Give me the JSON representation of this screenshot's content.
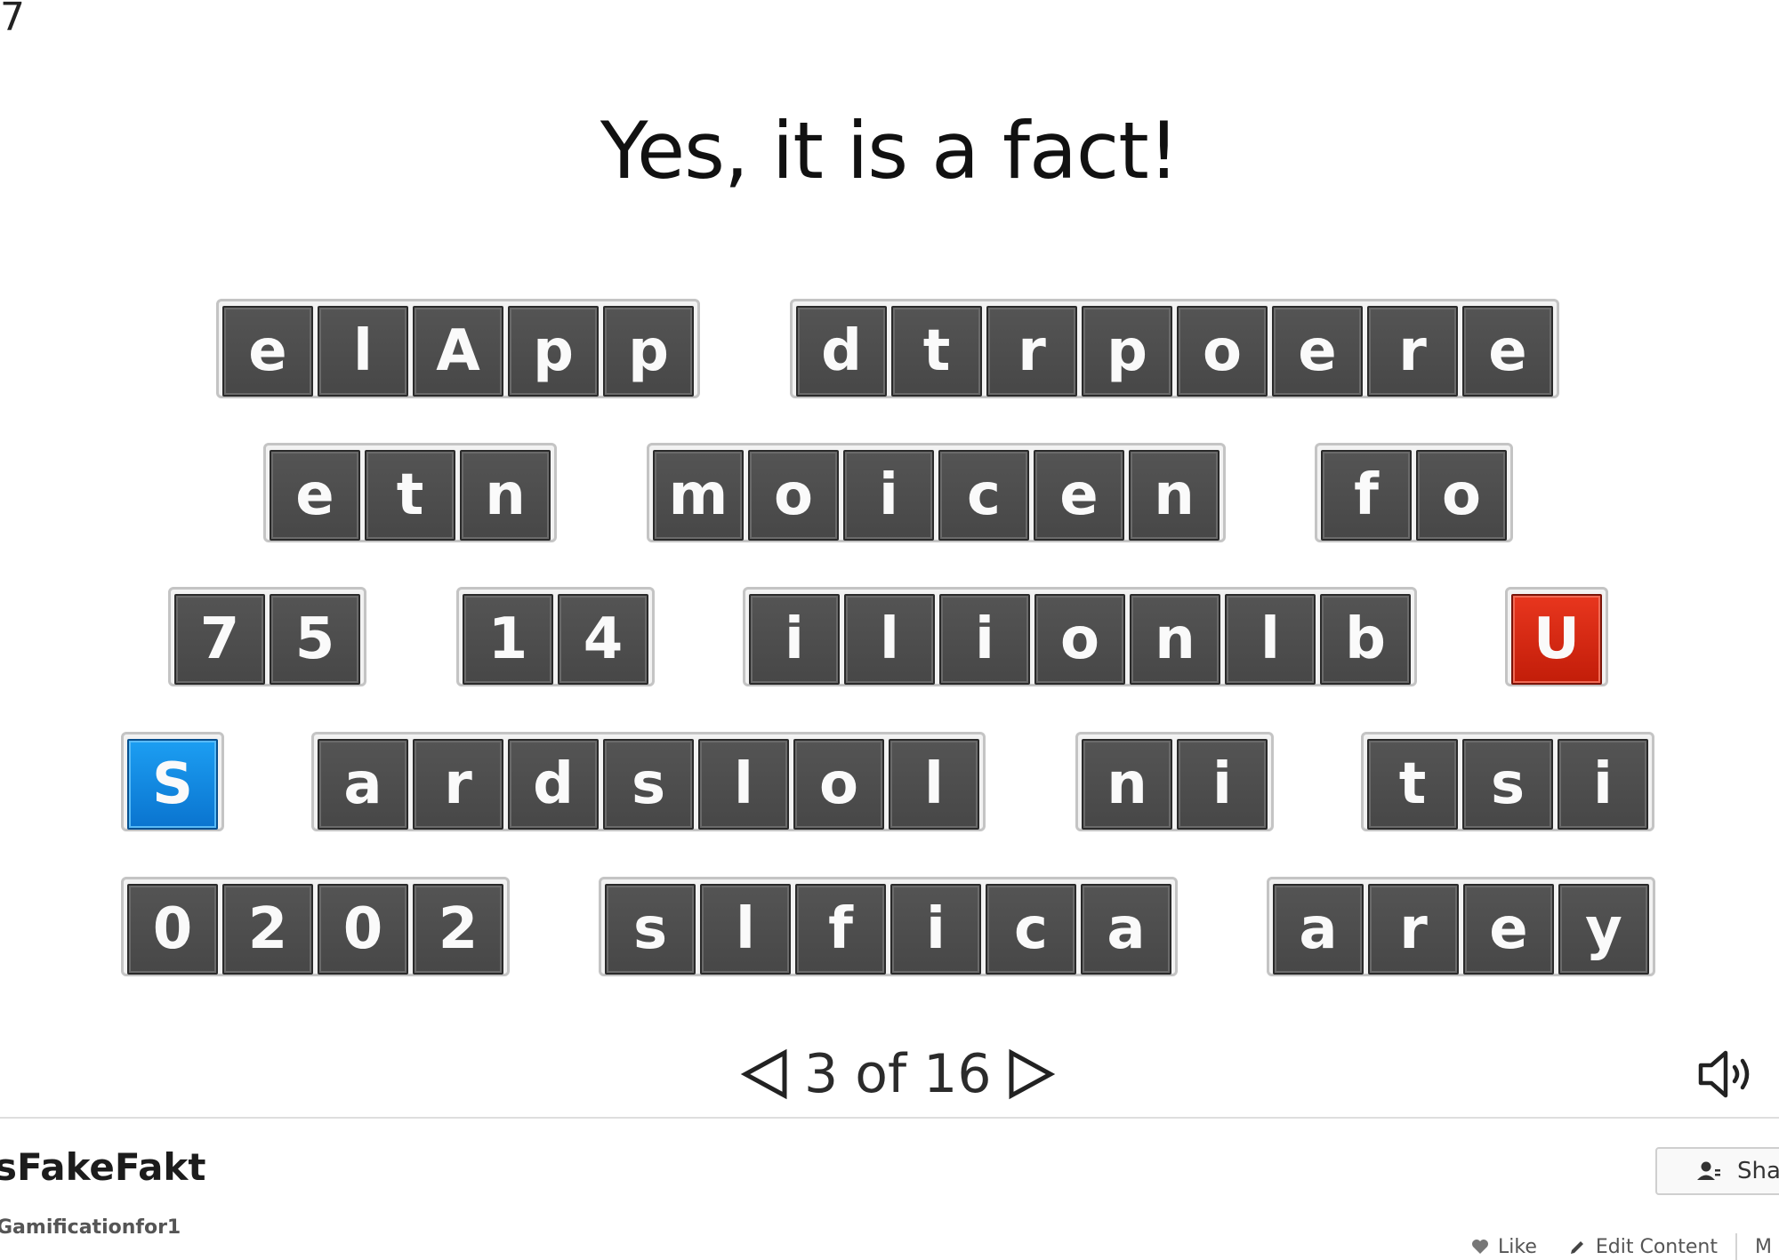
{
  "corner_number": "7",
  "game": {
    "title": "Yes, it is a fact!",
    "rows": [
      [
        {
          "letters": [
            "e",
            "l",
            "A",
            "p",
            "p"
          ]
        },
        {
          "letters": [
            "d",
            "t",
            "r",
            "p",
            "o",
            "e",
            "r",
            "e"
          ]
        }
      ],
      [
        {
          "letters": [
            "e",
            "t",
            "n"
          ]
        },
        {
          "letters": [
            "m",
            "o",
            "i",
            "c",
            "e",
            "n"
          ]
        },
        {
          "letters": [
            "f",
            "o"
          ]
        }
      ],
      [
        {
          "letters": [
            "7",
            "5"
          ]
        },
        {
          "letters": [
            "1",
            "4"
          ]
        },
        {
          "letters": [
            "i",
            "l",
            "i",
            "o",
            "n",
            "l",
            "b"
          ]
        },
        {
          "letters": [
            "U"
          ],
          "color": "red"
        }
      ],
      [
        {
          "letters": [
            "S"
          ],
          "color": "blue"
        },
        {
          "letters": [
            "a",
            "r",
            "d",
            "s",
            "l",
            "o",
            "l"
          ]
        },
        {
          "letters": [
            "n",
            "i"
          ]
        },
        {
          "letters": [
            "t",
            "s",
            "i"
          ]
        }
      ],
      [
        {
          "letters": [
            "0",
            "2",
            "0",
            "2"
          ]
        },
        {
          "letters": [
            "s",
            "l",
            "f",
            "i",
            "c",
            "a"
          ]
        },
        {
          "letters": [
            "a",
            "r",
            "e",
            "y"
          ]
        }
      ]
    ],
    "colors": {
      "tile": "#4f4f4f",
      "red_tile": "#d62811",
      "blue_tile": "#1186e0"
    }
  },
  "navigation": {
    "counter": "3 of 16"
  },
  "footer": {
    "app_title": "sFakeFakt",
    "author": "Gamificationfor1",
    "share_label": "Sha",
    "like_label": "Like",
    "edit_label": "Edit Content",
    "more_label": "M"
  },
  "icons": {
    "prev": "prev-arrow-icon",
    "next": "next-arrow-icon",
    "audio": "speaker-icon",
    "share": "user-icon",
    "like": "heart-icon",
    "edit": "pencil-icon"
  }
}
